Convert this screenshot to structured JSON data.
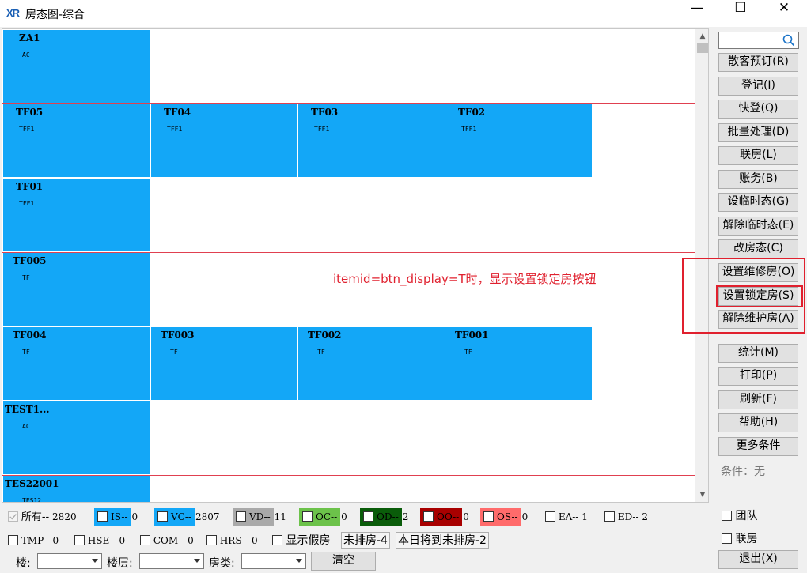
{
  "window": {
    "logo": "XR",
    "title": "房态图-综合",
    "minimize": "—",
    "maximize": "☐",
    "close": "✕"
  },
  "rooms": [
    {
      "name": "ZA1",
      "type": "AC"
    },
    {
      "name": "TF05",
      "type": "TFF1"
    },
    {
      "name": "TF04",
      "type": "TFF1"
    },
    {
      "name": "TF03",
      "type": "TFF1"
    },
    {
      "name": "TF02",
      "type": "TFF1"
    },
    {
      "name": "TF01",
      "type": "TFF1"
    },
    {
      "name": "TF005",
      "type": "TF"
    },
    {
      "name": "TF004",
      "type": "TF"
    },
    {
      "name": "TF003",
      "type": "TF"
    },
    {
      "name": "TF002",
      "type": "TF"
    },
    {
      "name": "TF001",
      "type": "TF"
    },
    {
      "name": "TEST1...",
      "type": "AC"
    },
    {
      "name": "TES22001",
      "type": "TES12"
    }
  ],
  "annotation": "itemid=btn_display=T时，显示设置锁定房按钮",
  "side_buttons": {
    "walkin_reserve": "散客预订(R)",
    "checkin": "登记(I)",
    "quick_checkin": "快登(Q)",
    "batch": "批量处理(D)",
    "link_room": "联房(L)",
    "account": "账务(B)",
    "set_temp": "设临时态(G)",
    "release_temp": "解除临时态(E)",
    "change_status": "改房态(C)",
    "set_repair": "设置维修房(O)",
    "set_lock": "设置锁定房(S)",
    "release_maintain": "解除维护房(A)",
    "stats": "统计(M)",
    "print": "打印(P)",
    "refresh": "刷新(F)",
    "help": "帮助(H)",
    "more_conditions": "更多条件",
    "exit": "退出(X)"
  },
  "condition_text": "条件：无",
  "side_checks": {
    "group": "团队",
    "linked": "联房"
  },
  "colors": {
    "room_vc": "#13a7f7",
    "annotation": "#e0202e",
    "vd": "#a9a9a9",
    "oc": "#6cc24a",
    "od": "#0a5c0a",
    "oo": "#a80000",
    "os": "#ff6b6b"
  },
  "legend": {
    "all": {
      "label": "所有--",
      "count": "2820"
    },
    "is": {
      "label": "IS--",
      "count": "0"
    },
    "vc": {
      "label": "VC--",
      "count": "2807"
    },
    "vd": {
      "label": "VD--",
      "count": "11"
    },
    "oc": {
      "label": "OC--",
      "count": "0"
    },
    "od": {
      "label": "OD--",
      "count": "2"
    },
    "oo": {
      "label": "OO--",
      "count": "0"
    },
    "os": {
      "label": "OS--",
      "count": "0"
    },
    "ea": {
      "label": "EA--",
      "count": "1"
    },
    "ed": {
      "label": "ED--",
      "count": "2"
    },
    "tmp": {
      "label": "TMP--",
      "count": "0"
    },
    "hse": {
      "label": "HSE--",
      "count": "0"
    },
    "com": {
      "label": "COM--",
      "count": "0"
    },
    "hrs": {
      "label": "HRS--",
      "count": "0"
    },
    "show_fake": "显示假房",
    "unassigned": "未排房-4",
    "today_unassigned": "本日将到未排房-2"
  },
  "filters": {
    "floor_building": "楼:",
    "floor_level": "楼层:",
    "room_type": "房类:",
    "clear": "清空"
  }
}
